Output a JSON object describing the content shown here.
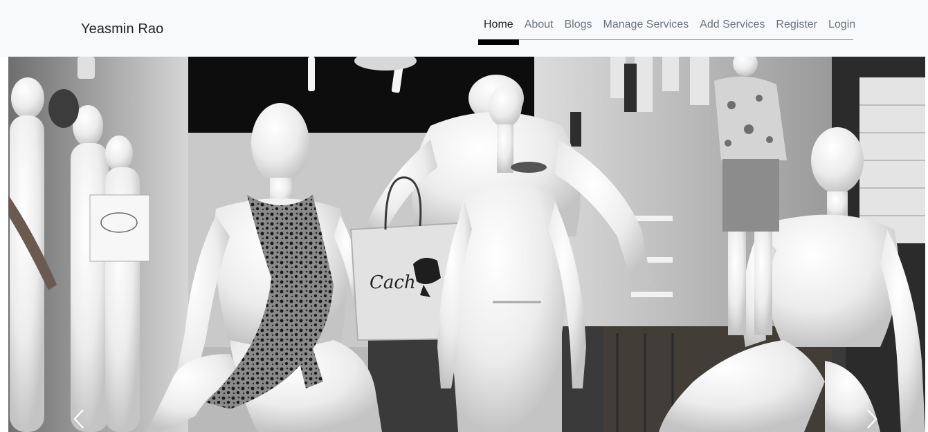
{
  "navbar": {
    "brand": "Yeasmin Rao",
    "links": [
      {
        "label": "Home",
        "active": true
      },
      {
        "label": "About"
      },
      {
        "label": "Blogs"
      },
      {
        "label": "Manage Services"
      },
      {
        "label": "Add Services"
      },
      {
        "label": "Register"
      },
      {
        "label": "Login"
      }
    ]
  },
  "carousel": {
    "slide_image": "black-and-white-mannequin-store-photo",
    "bag_text": "Cach",
    "prev_icon": "chevron-left-icon",
    "next_icon": "chevron-right-icon"
  },
  "colors": {
    "navbar_bg": "#f8f9fa",
    "active_link": "#212529",
    "inactive_link": "#6c757d",
    "active_indicator": "#000000"
  }
}
